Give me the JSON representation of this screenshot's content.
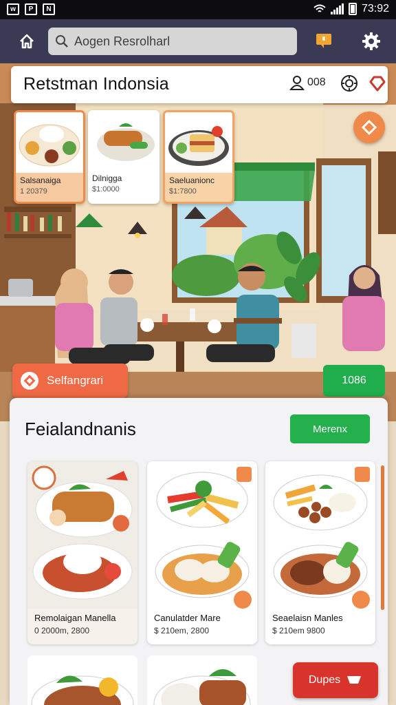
{
  "status_bar": {
    "time": "73:92"
  },
  "search": {
    "placeholder": "Aogen Resrolharl"
  },
  "header": {
    "title": "Retstman Indonsia",
    "user_count": "008"
  },
  "featured": [
    {
      "name": "Salsanaiga",
      "price": "1 20379"
    },
    {
      "name": "Dilnigga",
      "price": "$1:0000"
    },
    {
      "name": "Saeluanionc",
      "price": "$1:7800"
    }
  ],
  "actions": {
    "category_label": "Selfangrari",
    "green_label": "1086"
  },
  "menu": {
    "title": "Feialandnanis",
    "view_label": "Merenx",
    "items": [
      {
        "name": "Remolaigan Manella",
        "price": "0 2000m, 2800"
      },
      {
        "name": "Canulatder Mare",
        "price": "$ 210em, 2800"
      },
      {
        "name": "Seaelaisn Manles",
        "price": "$ 210em 9800"
      }
    ]
  },
  "order_button": {
    "label": "Dupes"
  },
  "colors": {
    "appbar": "#3a3a54",
    "accent_orange": "#ef6a44",
    "accent_green": "#1fae4b",
    "order_red": "#d8342c"
  },
  "icons": [
    "home-icon",
    "search-icon",
    "notification-icon",
    "gear-icon",
    "user-icon",
    "settings-icon",
    "heart-icon",
    "cart-icon"
  ]
}
